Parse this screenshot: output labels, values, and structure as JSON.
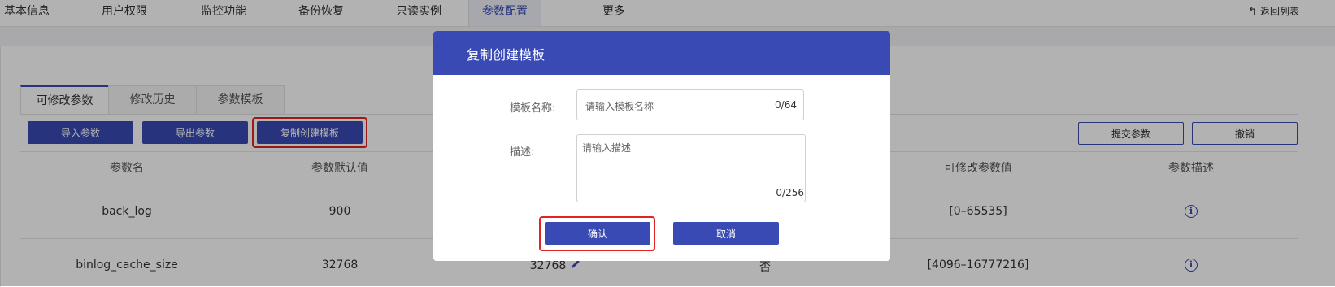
{
  "topnav": {
    "tabs": [
      {
        "label": "基本信息"
      },
      {
        "label": "用户权限"
      },
      {
        "label": "监控功能"
      },
      {
        "label": "备份恢复"
      },
      {
        "label": "只读实例"
      },
      {
        "label": "参数配置"
      },
      {
        "label": "更多"
      }
    ],
    "active_index": 5,
    "back_label": "返回列表"
  },
  "subtabs": [
    {
      "label": "可修改参数"
    },
    {
      "label": "修改历史"
    },
    {
      "label": "参数模板"
    }
  ],
  "toolbar": {
    "import_label": "导入参数",
    "export_label": "导出参数",
    "copy_template_label": "复制创建模板",
    "submit_label": "提交参数",
    "cancel_label": "撤销"
  },
  "table": {
    "headers": [
      "参数名",
      "参数默认值",
      "可修改参数值",
      "参数描述"
    ],
    "rows": [
      {
        "name": "back_log",
        "default": "900",
        "current": "",
        "restart": "",
        "range": "[0–65535]"
      },
      {
        "name": "binlog_cache_size",
        "default": "32768",
        "current": "32768",
        "restart": "否",
        "range": "[4096–16777216]"
      }
    ]
  },
  "modal": {
    "title": "复制创建模板",
    "name_label": "模板名称:",
    "name_placeholder": "请输入模板名称",
    "name_count": "0/64",
    "desc_label": "描述:",
    "desc_placeholder": "请输入描述",
    "desc_count": "0/256",
    "confirm_label": "确认",
    "cancel_label": "取消"
  },
  "colors": {
    "primary": "#3a4ab5",
    "highlight": "#e02424",
    "overlay": "rgba(0,0,0,0.30)"
  }
}
